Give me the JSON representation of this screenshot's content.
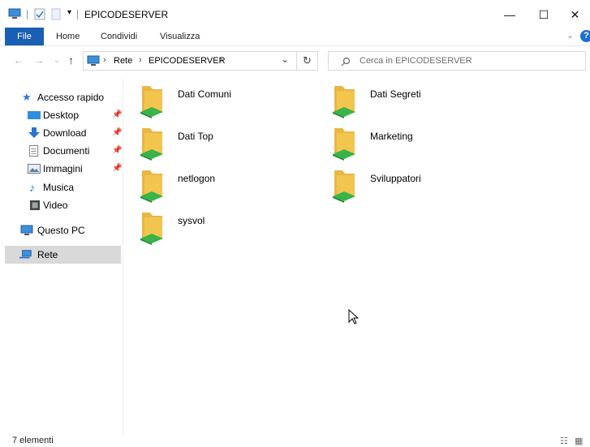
{
  "window": {
    "title": "EPICODESERVER"
  },
  "ribbon": {
    "tabs": [
      "File",
      "Home",
      "Condividi",
      "Visualizza"
    ]
  },
  "address": {
    "segments": [
      "Rete",
      "EPICODESERVER"
    ],
    "search_placeholder": "Cerca in EPICODESERVER"
  },
  "sidebar": {
    "quick_access": "Accesso rapido",
    "items": [
      {
        "label": "Desktop",
        "icon": "desktop-icon",
        "pinned": true
      },
      {
        "label": "Download",
        "icon": "download-icon",
        "pinned": true
      },
      {
        "label": "Documenti",
        "icon": "documents-icon",
        "pinned": true
      },
      {
        "label": "Immagini",
        "icon": "pictures-icon",
        "pinned": true
      },
      {
        "label": "Musica",
        "icon": "music-icon",
        "pinned": false
      },
      {
        "label": "Video",
        "icon": "video-icon",
        "pinned": false
      }
    ],
    "this_pc": "Questo PC",
    "network": "Rete"
  },
  "folders": [
    "Dati Comuni",
    "Dati Segreti",
    "Dati Top",
    "Marketing",
    "netlogon",
    "Sviluppatori",
    "sysvol"
  ],
  "status": {
    "count": "7 elementi"
  },
  "colors": {
    "accent": "#1a5fb4",
    "selected": "#d9d9d9",
    "folder": "#f3c54e",
    "share": "#39b34a"
  }
}
